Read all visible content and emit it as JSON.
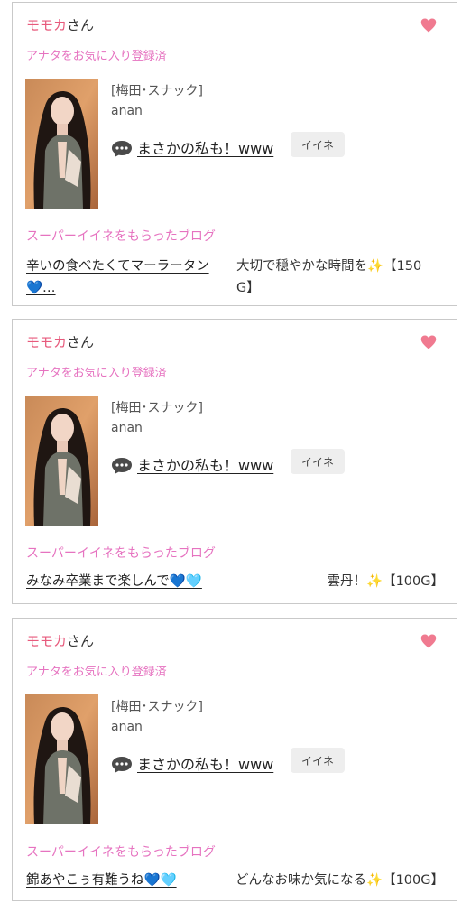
{
  "cards": [
    {
      "name": "モモカ",
      "name_suffix": "さん",
      "favorite_status": "アナタをお気に入り登録済",
      "shop": "[梅田･スナック]",
      "cast": "anan",
      "comment": "まさかの私も！www",
      "iine_label": "イイネ",
      "super_heading": "スーパーイイネをもらったブログ",
      "blog_title_line1": "辛いの食べたくてマーラータン",
      "blog_title_line2": "💙…",
      "blog_message_line1": "大切で穏やかな時間を✨【150",
      "blog_message_line2": "G】"
    },
    {
      "name": "モモカ",
      "name_suffix": "さん",
      "favorite_status": "アナタをお気に入り登録済",
      "shop": "[梅田･スナック]",
      "cast": "anan",
      "comment": "まさかの私も！www",
      "iine_label": "イイネ",
      "super_heading": "スーパーイイネをもらったブログ",
      "blog_title_line1": "みなみ卒業まで楽しんで💙🩵",
      "blog_message_line1": "雲丹！✨【100G】"
    },
    {
      "name": "モモカ",
      "name_suffix": "さん",
      "favorite_status": "アナタをお気に入り登録済",
      "shop": "[梅田･スナック]",
      "cast": "anan",
      "comment": "まさかの私も！www",
      "iine_label": "イイネ",
      "super_heading": "スーパーイイネをもらったブログ",
      "blog_title_line1": "錦あやこぅ有難うね💙🩵",
      "blog_message_line1": "どんなお味か気になる✨【100G】"
    }
  ],
  "colors": {
    "accent_pink": "#e75a7c",
    "label_pink": "#e673c0",
    "heart": "#f07a90",
    "border": "#c9c9c9"
  },
  "icons": [
    "heart-icon",
    "speech-bubble-icon"
  ]
}
